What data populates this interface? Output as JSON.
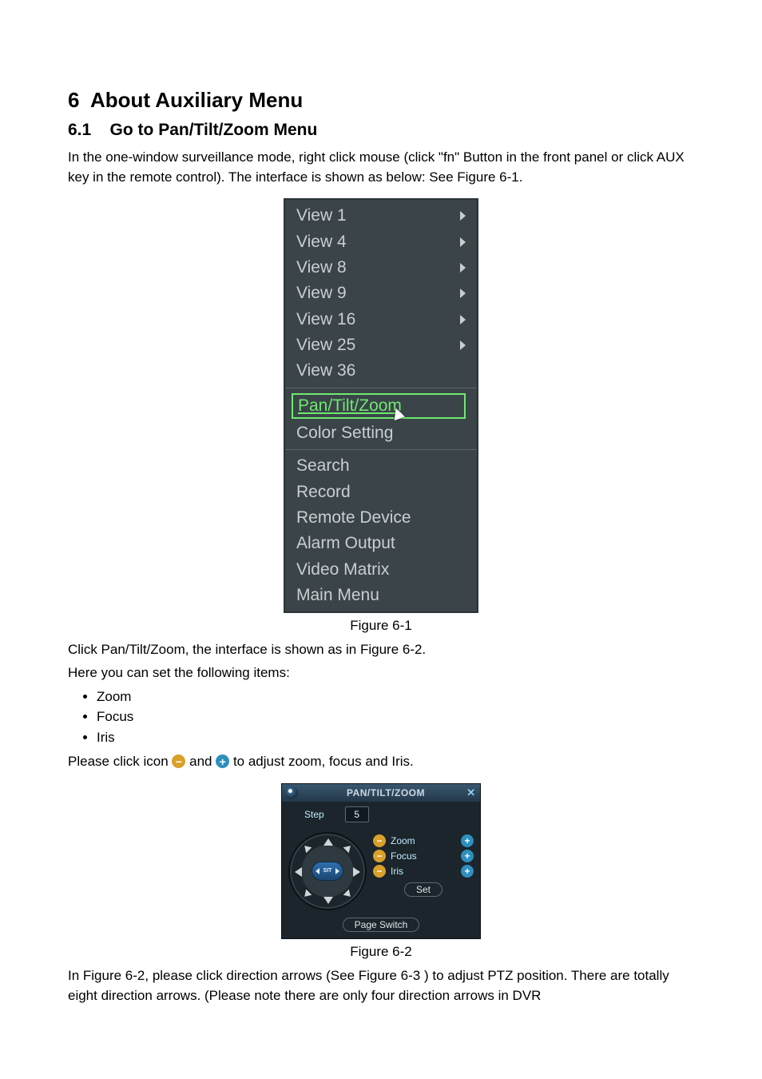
{
  "section": {
    "number": "6",
    "title": "About Auxiliary Menu"
  },
  "subsection": {
    "number": "6.1",
    "title": "Go to Pan/Tilt/Zoom Menu"
  },
  "intro_text": "In the one-window surveillance mode, right click mouse (click \"fn\" Button in the front panel or click AUX key in the remote control). The interface is shown as below: See Figure 6-1.",
  "context_menu": {
    "group1": [
      {
        "label": "View 1",
        "has_submenu": true
      },
      {
        "label": "View 4",
        "has_submenu": true
      },
      {
        "label": "View 8",
        "has_submenu": true
      },
      {
        "label": "View 9",
        "has_submenu": true
      },
      {
        "label": "View 16",
        "has_submenu": true
      },
      {
        "label": "View 25",
        "has_submenu": true
      },
      {
        "label": "View 36",
        "has_submenu": false
      }
    ],
    "group2_highlight": "Pan/Tilt/Zoom",
    "group2_second": "Color Setting",
    "group3": [
      "Search",
      "Record",
      "Remote Device",
      "Alarm Output",
      "Video Matrix",
      "Main Menu"
    ]
  },
  "caption1": "Figure 6-1",
  "after_fig1_a": "Click Pan/Tilt/Zoom, the interface is shown as in Figure 6-2.",
  "after_fig1_b": "Here you can set the following items:",
  "bullets": [
    "Zoom",
    "Focus",
    "Iris"
  ],
  "icons_text_a": "Please click icon ",
  "icons_text_b": " and ",
  "icons_text_c": " to adjust zoom, focus and Iris.",
  "ptz_panel": {
    "title": "PAN/TILT/ZOOM",
    "step_label": "Step",
    "step_value": "5",
    "rows": [
      {
        "label": "Zoom"
      },
      {
        "label": "Focus"
      },
      {
        "label": "Iris"
      }
    ],
    "set_label": "Set",
    "page_switch_label": "Page Switch",
    "center_label": "SIT"
  },
  "caption2": "Figure 6-2",
  "after_fig2": "In Figure 6-2, please click direction arrows (See Figure 6-3 ) to adjust PTZ position. There are totally eight direction arrows. (Please note there are only four direction arrows in DVR"
}
